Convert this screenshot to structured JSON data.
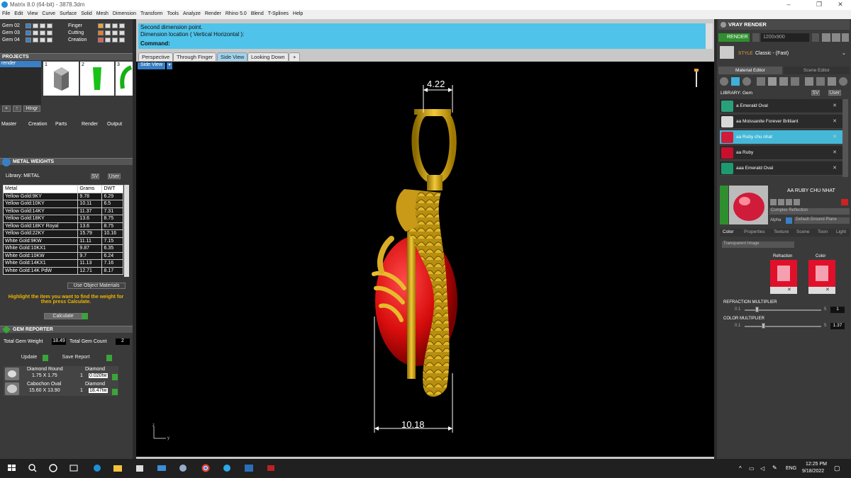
{
  "window": {
    "title": "Matrix 8.0 (64-bit) - 3878.3dm",
    "controls": [
      "–",
      "❐",
      "✕"
    ]
  },
  "menu": [
    "File",
    "Edit",
    "View",
    "Curve",
    "Surface",
    "Solid",
    "Mesh",
    "Dimension",
    "Transform",
    "Tools",
    "Analyze",
    "Render",
    "Rhino 5.0",
    "Blend",
    "T-Splines",
    "Help"
  ],
  "layers": {
    "gems": [
      "Gem 02",
      "Gem 03",
      "Gem 04"
    ],
    "groups": [
      "Finger",
      "Cutting",
      "Creation"
    ]
  },
  "projects": {
    "title": "PROJECTS",
    "active_item": "render",
    "thumb_numbers": [
      "1",
      "2",
      "3"
    ],
    "hinge_label": "Hingr"
  },
  "stages": [
    "Master",
    "Creation",
    "Parts",
    "Render",
    "Output"
  ],
  "metal_weights": {
    "title": "METAL WEIGHTS",
    "library_label": "Library: METAL",
    "sv_label": "SV",
    "user_label": "User",
    "columns": [
      "Metal",
      "Grams",
      "DWT"
    ],
    "rows": [
      [
        "Yellow Gold:9KY",
        "9.78",
        "6.29"
      ],
      [
        "Yellow Gold:10KY",
        "10.11",
        "6.5"
      ],
      [
        "Yellow Gold:14KY",
        "11.37",
        "7.31"
      ],
      [
        "Yellow Gold:18KY",
        "13.6",
        "8.75"
      ],
      [
        "Yellow Gold:18KY Royal",
        "13.6",
        "8.75"
      ],
      [
        "Yellow Gold:22KY",
        "15.79",
        "10.16"
      ],
      [
        "White Gold:9KW",
        "11.11",
        "7.15"
      ],
      [
        "White Gold:10KX1",
        "9.87",
        "6.35"
      ],
      [
        "White Gold:10KW",
        "9.7",
        "6.24"
      ],
      [
        "White Gold:14KX1",
        "11.13",
        "7.16"
      ],
      [
        "White Gold:14K PdW",
        "12.71",
        "8.17"
      ]
    ],
    "use_object_materials": "Use Object Materials",
    "hint": "Highlight the item you want to find the weight for then press Calculate.",
    "calculate_label": "Calculate"
  },
  "gem_reporter": {
    "title": "GEM REPORTER",
    "total_weight_label": "Total Gem Weight",
    "total_weight_value": "18.49",
    "total_count_label": "Total Gem Count",
    "total_count_value": "2",
    "update_label": "Update",
    "save_report_label": "Save Report",
    "gems": [
      {
        "name": "Diamond Round",
        "material": "Diamond",
        "size": "1.75 X 1.75",
        "qty": "1",
        "weight": "0.020tw"
      },
      {
        "name": "Cabochon Oval",
        "material": "Diamond",
        "size": "15.60 X 13.90",
        "qty": "1",
        "weight": "18.47tw"
      }
    ]
  },
  "command": {
    "line1": "Second dimension point.",
    "line2": "Dimension location ( Vertical  Horizontal ):",
    "prompt": "Command:"
  },
  "view_tabs": [
    "Perspective",
    "Through Finger",
    "Side View",
    "Looking Down",
    "+"
  ],
  "active_view_tab": "Side View",
  "viewport": {
    "label": "Side View",
    "dim_top": "4.22",
    "dim_bottom": "10.18",
    "axis_z": "z",
    "axis_y": "y"
  },
  "vray": {
    "title": "VRAY RENDER",
    "render_label": "RENDER",
    "resolution": "1200x900",
    "style_label": "STYLE",
    "style_value": "Classic - (Fast)",
    "tabs": [
      "Material Editor",
      "Scene Editor"
    ],
    "library_label": "LIBRARY: Gem",
    "sv_label": "SV",
    "user_label": "User",
    "materials": [
      {
        "name": "a Emerald Oval",
        "color": "#2aa07a"
      },
      {
        "name": "aa Moissanite Forever Brilliant",
        "color": "#d8d8d8"
      },
      {
        "name": "aa Ruby chu nhat",
        "color": "#d01c3a"
      },
      {
        "name": "aa Ruby",
        "color": "#c8102e"
      },
      {
        "name": "aaa Emerald Oval",
        "color": "#1e9a70"
      }
    ],
    "selected_material": "aa Ruby chu nhat",
    "preview_title": "AA RUBY CHU NHAT",
    "material_type": "Complex Reflection",
    "alpha_label": "Alpha",
    "ground_label": "Default Ground Plane",
    "prop_tabs": [
      "Color",
      "Properties",
      "Texture",
      "Scene",
      "Toon",
      "Light"
    ],
    "transparent_mode": "Transparent Image",
    "refraction_label": "Refraction",
    "color_label": "Color",
    "refraction_multiplier_label": "REFRACTION MULTIPLIER",
    "refraction_min": "0.1",
    "refraction_max": "5",
    "refraction_value": "1",
    "color_multiplier_label": "COLOR MULTIPLIER",
    "color_min": "0.1",
    "color_max": "5",
    "color_value": "1.37"
  },
  "taskbar": {
    "language": "ENG",
    "time": "12:25 PM",
    "date": "9/18/2022"
  }
}
